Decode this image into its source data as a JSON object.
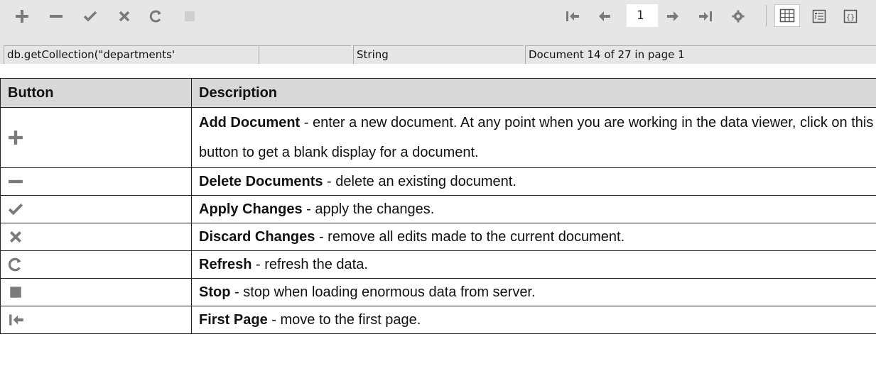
{
  "toolbar": {
    "icons": [
      "add-icon",
      "minus-icon",
      "check-icon",
      "close-icon",
      "refresh-icon",
      "stop-icon",
      "first-page-icon",
      "previous-page-icon",
      "next-page-icon",
      "last-page-icon",
      "gear-icon",
      "grid-view-icon",
      "tree-view-icon",
      "json-view-icon"
    ],
    "page_number": "1"
  },
  "status_bar": {
    "query": "db.getCollection(\"departments'",
    "field_value": "",
    "type": "String",
    "document_info": "Document 14 of 27 in page 1"
  },
  "table": {
    "headers": [
      "Button",
      "Description"
    ],
    "rows": [
      {
        "icon": "add-icon",
        "title": "Add Document",
        "desc": " - enter a new document. At any point when you are working in the data viewer, click on this button to get a blank display for a document."
      },
      {
        "icon": "minus-icon",
        "title": "Delete Documents",
        "desc": " - delete an existing document."
      },
      {
        "icon": "check-icon",
        "title": "Apply Changes",
        "desc": " - apply the changes."
      },
      {
        "icon": "close-icon",
        "title": "Discard Changes",
        "desc": " - remove all edits made to the current document."
      },
      {
        "icon": "refresh-icon",
        "title": "Refresh",
        "desc": " - refresh the data."
      },
      {
        "icon": "stop-icon",
        "title": "Stop",
        "desc": " - stop when loading enormous data from server."
      },
      {
        "icon": "first-page-icon",
        "title": "First Page",
        "desc": " - move to the first page."
      }
    ]
  },
  "colors": {
    "toolbar_bg": "#e6e6e6",
    "icon": "#7a7a7a",
    "icon_disabled": "#cfcfcf",
    "header_bg": "#d8d8d8"
  }
}
